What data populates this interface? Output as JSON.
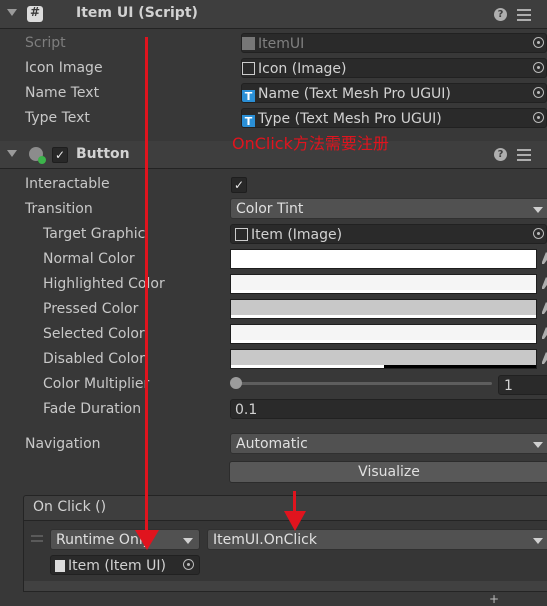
{
  "item_ui": {
    "title": "Item UI (Script)",
    "fields": [
      {
        "label": "Script",
        "value": "ItemUI"
      },
      {
        "label": "Icon Image",
        "value": "Icon (Image)"
      },
      {
        "label": "Name Text",
        "value": "Name (Text Mesh Pro UGUI)"
      },
      {
        "label": "Type Text",
        "value": "Type (Text Mesh Pro UGUI)"
      }
    ]
  },
  "annotation": "OnClick方法需要注册",
  "button_component": {
    "title": "Button",
    "enabled_check": "✓",
    "interactable": {
      "label": "Interactable",
      "check": "✓"
    },
    "transition": {
      "label": "Transition",
      "value": "Color Tint"
    },
    "target_graphic": {
      "label": "Target Graphic",
      "value": "Item (Image)"
    },
    "colors": [
      {
        "label": "Normal Color",
        "color": "#ffffff"
      },
      {
        "label": "Highlighted Color",
        "color": "#f5f5f5"
      },
      {
        "label": "Pressed Color",
        "color": "#c8c8c8"
      },
      {
        "label": "Selected Color",
        "color": "#f5f5f5"
      },
      {
        "label": "Disabled Color",
        "color": "#c8c8c8"
      }
    ],
    "color_multiplier": {
      "label": "Color Multiplier",
      "value": "1",
      "level": 0.0
    },
    "fade_duration": {
      "label": "Fade Duration",
      "value": "0.1"
    },
    "navigation": {
      "label": "Navigation",
      "value": "Automatic"
    },
    "visualize_label": "Visualize",
    "on_click": {
      "header": "On Click ()",
      "runtime": "Runtime Only",
      "function": "ItemUI.OnClick",
      "target": "Item (Item UI)"
    }
  },
  "colors": {
    "accent_red": "#e0141e",
    "bg": "#383838"
  }
}
